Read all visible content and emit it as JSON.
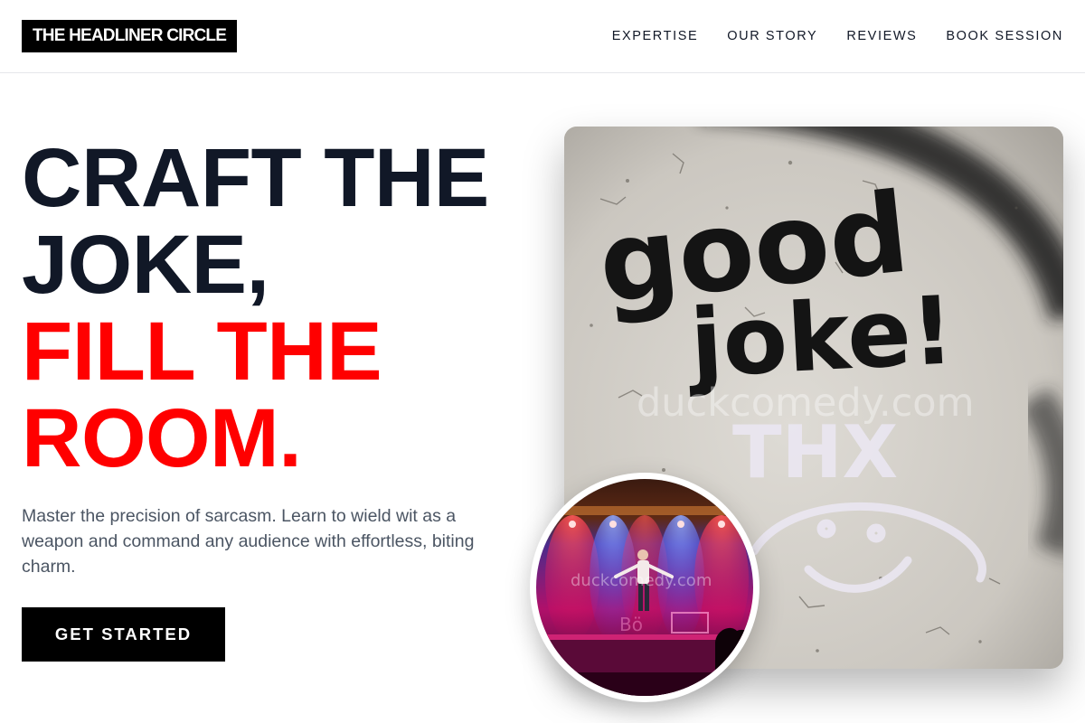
{
  "header": {
    "logo": "THE HEADLINER CIRCLE",
    "nav": [
      "EXPERTISE",
      "OUR STORY",
      "REVIEWS",
      "BOOK SESSION"
    ]
  },
  "hero": {
    "headline_line1": "CRAFT THE",
    "headline_line2": "JOKE,",
    "headline_line3": "FILL THE",
    "headline_line4": "ROOM.",
    "lead": "Master the precision of sarcasm. Learn to wield wit as a weapon and command any audience with effortless, biting charm.",
    "cta": "GET STARTED"
  },
  "images": {
    "main_graffiti_line1": "good",
    "main_graffiti_line2": "joke!",
    "main_graffiti_line3": "THX",
    "main_watermark": "duckcomedy.com",
    "inset_watermark": "duckcomedy.com",
    "inset_sign": "Bö"
  },
  "colors": {
    "accent": "#ff0000",
    "dark_text": "#111827",
    "muted_text": "#4b5563",
    "button_bg": "#000000"
  }
}
